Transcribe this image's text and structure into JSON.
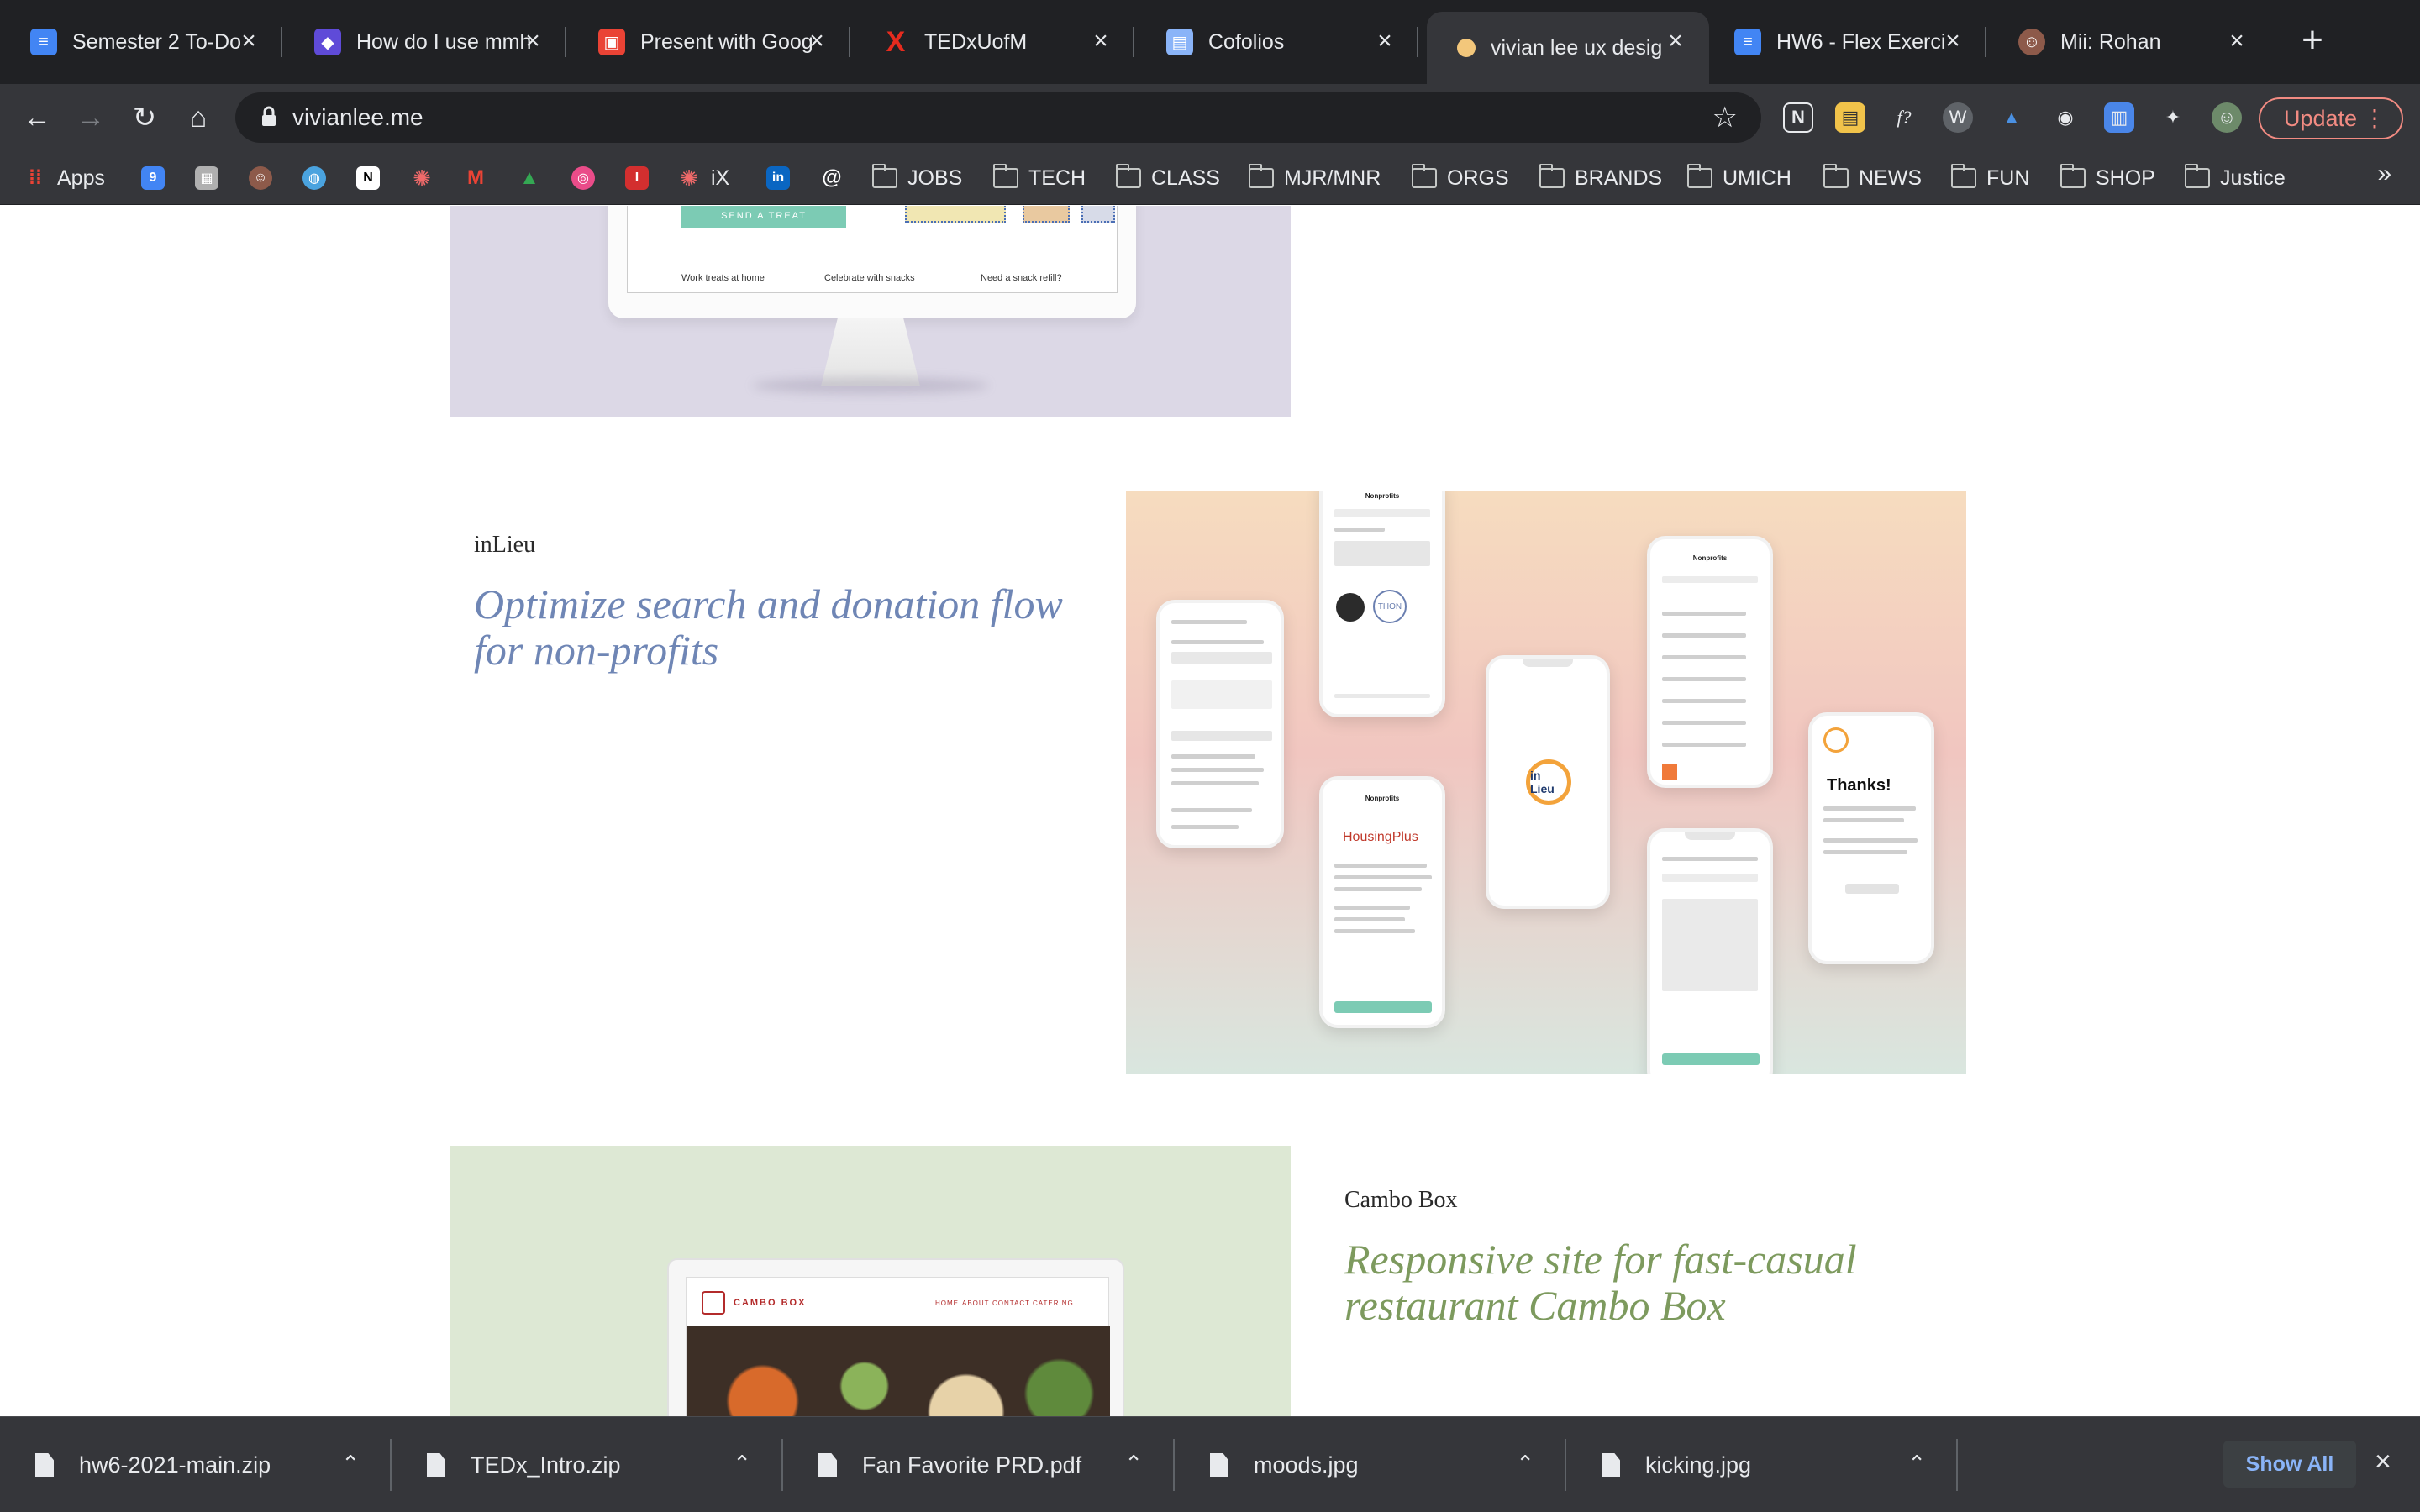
{
  "browser": {
    "tabs": [
      {
        "title": "Semester 2 To-Do",
        "icon": "docs-icon",
        "color": "#4285f4",
        "glyph": "≡"
      },
      {
        "title": "How do I use mmh",
        "icon": "cube-icon",
        "color": "#5f4bd8",
        "glyph": "◆"
      },
      {
        "title": "Present with Goog",
        "icon": "present-icon",
        "color": "#ea4335",
        "glyph": "▣"
      },
      {
        "title": "TEDxUofM",
        "icon": "tedx-icon",
        "color": "#e62b1e",
        "glyph": "X"
      },
      {
        "title": "Cofolios",
        "icon": "page-icon",
        "color": "#8ab4f8",
        "glyph": "▤"
      },
      {
        "title": "vivian lee ux desig",
        "icon": "emoji-icon",
        "color": "#f3c77b",
        "glyph": "●"
      },
      {
        "title": "HW6 - Flex Exerci",
        "icon": "docs-icon",
        "color": "#4285f4",
        "glyph": "≡"
      },
      {
        "title": "Mii: Rohan",
        "icon": "avatar-icon",
        "color": "#8d5a4a",
        "glyph": "☺"
      }
    ],
    "url": "vivianlee.me",
    "update_label": "Update",
    "bookmarks": {
      "apps": "Apps",
      "ix": "iX",
      "folders": [
        "JOBS",
        "TECH",
        "CLASS",
        "MJR/MNR",
        "ORGS",
        "BRANDS",
        "UMICH",
        "NEWS",
        "FUN",
        "SHOP",
        "Justice"
      ]
    }
  },
  "page": {
    "top_tile": {
      "cta": "SEND A TREAT",
      "captions": [
        "Work treats at home",
        "Celebrate with snacks",
        "Need a snack refill?"
      ]
    },
    "projects": [
      {
        "name": "inLieu",
        "description": "Optimize search and donation flow for non-profits",
        "color": "#6f86b5"
      },
      {
        "name": "Cambo Box",
        "description": "Responsive site for fast-casual restaurant Cambo Box",
        "color": "#7d9a5e"
      }
    ],
    "inlieu_mock": {
      "screen_title": "Nonprofits",
      "logo": "in Lieu",
      "thanks": "Thanks!",
      "housing": "HousingPlus"
    },
    "cambo_mock": {
      "brand": "CAMBO BOX",
      "nav": [
        "HOME",
        "ABOUT",
        "CONTACT",
        "CATERING"
      ]
    }
  },
  "downloads": {
    "items": [
      "hw6-2021-main.zip",
      "TEDx_Intro.zip",
      "Fan Favorite PRD.pdf",
      "moods.jpg",
      "kicking.jpg"
    ],
    "show_all": "Show All"
  }
}
